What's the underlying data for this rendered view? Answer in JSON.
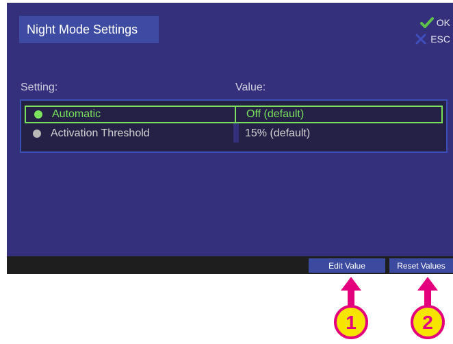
{
  "title": "Night Mode Settings",
  "hotkeys": {
    "ok_label": "OK",
    "esc_label": "ESC"
  },
  "columns": {
    "setting": "Setting:",
    "value": "Value:"
  },
  "rows": [
    {
      "setting": "Automatic",
      "value": "Off (default)",
      "selected": true
    },
    {
      "setting": "Activation Threshold",
      "value": "15% (default)",
      "selected": false
    }
  ],
  "buttons": {
    "edit": "Edit Value",
    "reset": "Reset Values"
  },
  "callouts": [
    "1",
    "2"
  ],
  "colors": {
    "screen_bg": "#35307c",
    "selection": "#7ae35b",
    "callout": "#e4007c",
    "callout_fill": "#f7e400"
  }
}
